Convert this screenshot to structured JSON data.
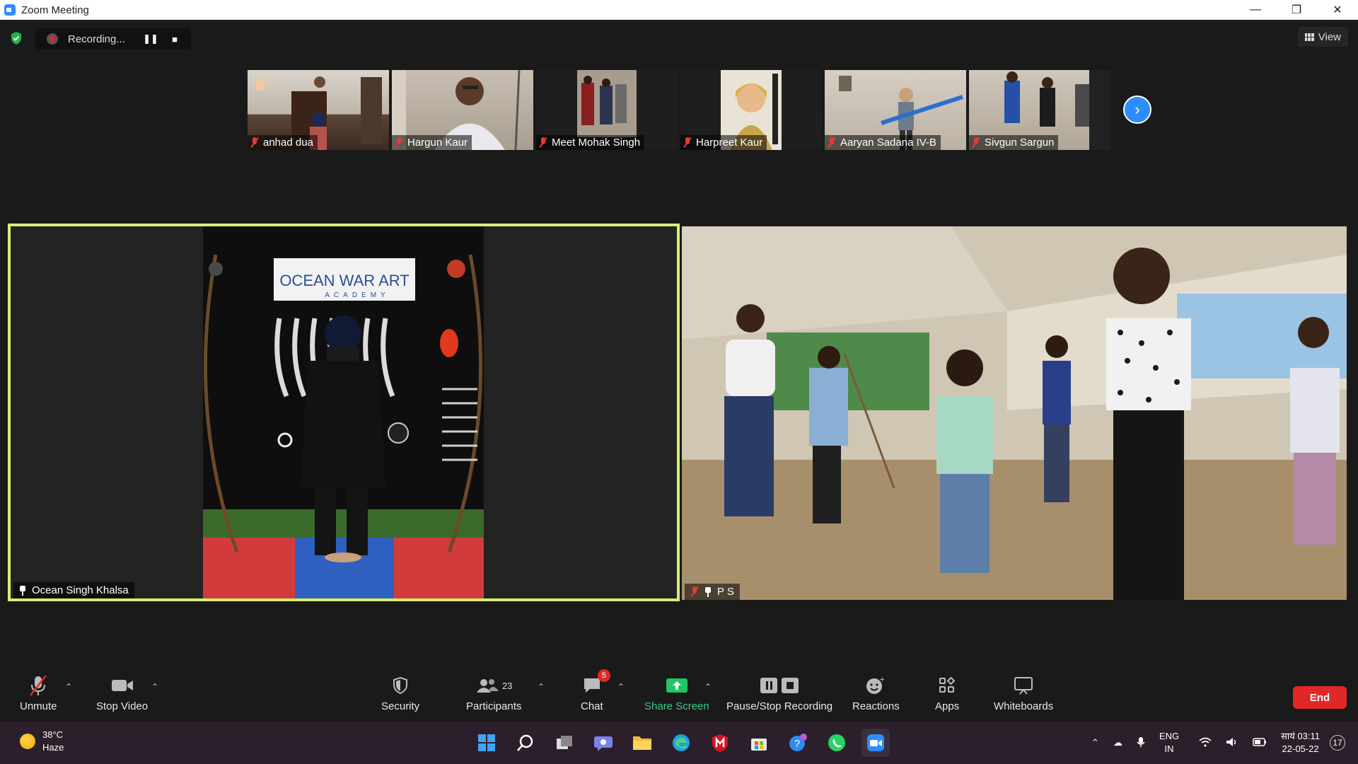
{
  "window": {
    "title": "Zoom Meeting",
    "controls": [
      "—",
      "❐",
      "✕"
    ]
  },
  "recording": {
    "label": "Recording..."
  },
  "view_button": {
    "label": "View"
  },
  "thumbnails": [
    {
      "name": "anhad dua"
    },
    {
      "name": "Hargun Kaur"
    },
    {
      "name": "Meet Mohak Singh"
    },
    {
      "name": "Harpreet Kaur"
    },
    {
      "name": "Aaryan Sadana IV-B"
    },
    {
      "name": "Sivgun Sargun"
    }
  ],
  "main_tiles": {
    "left": {
      "name": "Ocean Singh Khalsa",
      "banner": "OCEAN WAR ART",
      "banner_sub": "ACADEMY"
    },
    "right": {
      "name": "P S"
    }
  },
  "toolbar": {
    "unmute": "Unmute",
    "stop_video": "Stop Video",
    "security": "Security",
    "participants": "Participants",
    "participants_count": "23",
    "chat": "Chat",
    "chat_badge": "5",
    "share_screen": "Share Screen",
    "pause_stop_recording": "Pause/Stop Recording",
    "reactions": "Reactions",
    "apps": "Apps",
    "whiteboards": "Whiteboards",
    "end": "End"
  },
  "taskbar": {
    "weather_temp": "38°C",
    "weather_desc": "Haze",
    "lang_top": "ENG",
    "lang_bottom": "IN",
    "time": "सायं 03:11",
    "date": "22-05-22",
    "notifications": "17"
  },
  "colors": {
    "active_speaker_border": "#d6ef72",
    "zoom_blue": "#2d8cff",
    "end_red": "#e02828",
    "share_green": "#41c98a"
  }
}
